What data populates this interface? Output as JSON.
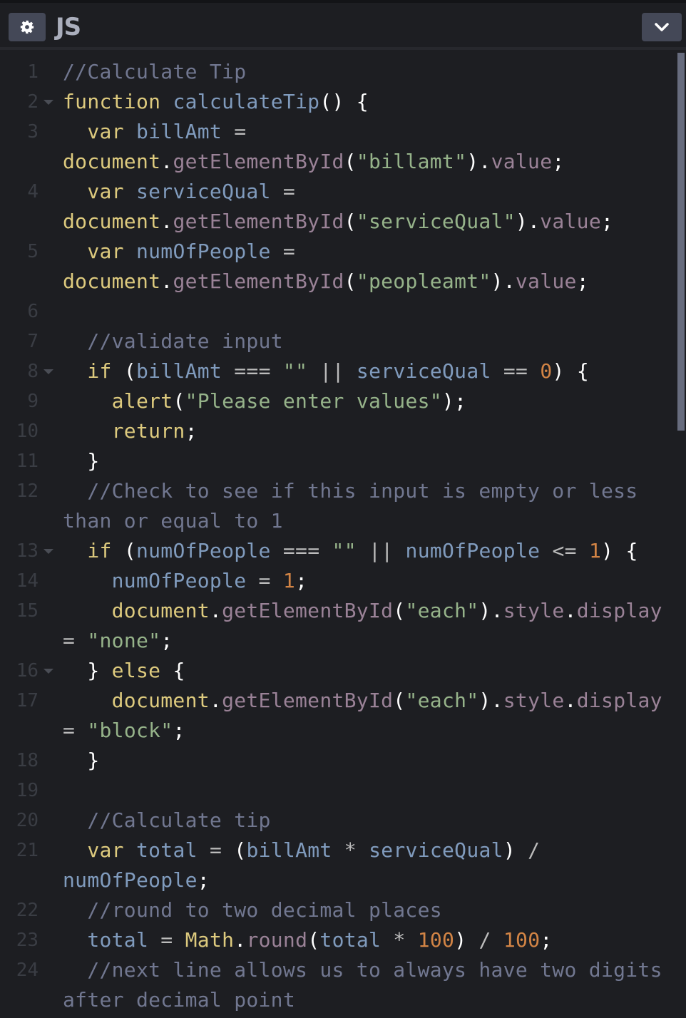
{
  "header": {
    "settings_icon": "gear-icon",
    "title": "JS",
    "collapse_icon": "chevron-down-icon"
  },
  "colors": {
    "background": "#1d1e22",
    "comment": "#717790",
    "keyword": "#ddca7e",
    "variable": "#809bbd",
    "property": "#9a8297",
    "string": "#96b38a",
    "number": "#d28445"
  },
  "code_lines": [
    {
      "n": "1",
      "fold": false,
      "tokens": [
        [
          "comment",
          "//Calculate Tip"
        ]
      ]
    },
    {
      "n": "2",
      "fold": true,
      "tokens": [
        [
          "keyword",
          "function"
        ],
        [
          "punct",
          " "
        ],
        [
          "def",
          "calculateTip"
        ],
        [
          "punct",
          "() {"
        ]
      ]
    },
    {
      "n": "3",
      "fold": false,
      "tokens": [
        [
          "punct",
          "  "
        ],
        [
          "keyword",
          "var"
        ],
        [
          "punct",
          " "
        ],
        [
          "def",
          "billAmt"
        ],
        [
          "punct",
          " "
        ],
        [
          "op",
          "="
        ],
        [
          "br",
          ""
        ],
        [
          "keyword",
          "document"
        ],
        [
          "punct",
          "."
        ],
        [
          "prop",
          "getElementById"
        ],
        [
          "punct",
          "("
        ],
        [
          "string",
          "\"billamt\""
        ],
        [
          "punct",
          ")."
        ],
        [
          "prop",
          "value"
        ],
        [
          "punct",
          ";"
        ]
      ]
    },
    {
      "n": "4",
      "fold": false,
      "tokens": [
        [
          "punct",
          "  "
        ],
        [
          "keyword",
          "var"
        ],
        [
          "punct",
          " "
        ],
        [
          "def",
          "serviceQual"
        ],
        [
          "punct",
          " "
        ],
        [
          "op",
          "="
        ],
        [
          "br",
          ""
        ],
        [
          "keyword",
          "document"
        ],
        [
          "punct",
          "."
        ],
        [
          "prop",
          "getElementById"
        ],
        [
          "punct",
          "("
        ],
        [
          "string",
          "\"serviceQual\""
        ],
        [
          "punct",
          ")."
        ],
        [
          "prop",
          "value"
        ],
        [
          "punct",
          ";"
        ]
      ]
    },
    {
      "n": "5",
      "fold": false,
      "tokens": [
        [
          "punct",
          "  "
        ],
        [
          "keyword",
          "var"
        ],
        [
          "punct",
          " "
        ],
        [
          "def",
          "numOfPeople"
        ],
        [
          "punct",
          " "
        ],
        [
          "op",
          "="
        ],
        [
          "br",
          ""
        ],
        [
          "keyword",
          "document"
        ],
        [
          "punct",
          "."
        ],
        [
          "prop",
          "getElementById"
        ],
        [
          "punct",
          "("
        ],
        [
          "string",
          "\"peopleamt\""
        ],
        [
          "punct",
          ")."
        ],
        [
          "prop",
          "value"
        ],
        [
          "punct",
          ";"
        ]
      ]
    },
    {
      "n": "6",
      "fold": false,
      "tokens": []
    },
    {
      "n": "7",
      "fold": false,
      "tokens": [
        [
          "punct",
          "  "
        ],
        [
          "comment",
          "//validate input"
        ]
      ]
    },
    {
      "n": "8",
      "fold": true,
      "tokens": [
        [
          "punct",
          "  "
        ],
        [
          "keyword",
          "if"
        ],
        [
          "punct",
          " ("
        ],
        [
          "var",
          "billAmt"
        ],
        [
          "punct",
          " "
        ],
        [
          "op",
          "==="
        ],
        [
          "punct",
          " "
        ],
        [
          "string",
          "\"\""
        ],
        [
          "punct",
          " "
        ],
        [
          "op",
          "||"
        ],
        [
          "punct",
          " "
        ],
        [
          "var",
          "serviceQual"
        ],
        [
          "punct",
          " "
        ],
        [
          "op",
          "=="
        ],
        [
          "punct",
          " "
        ],
        [
          "number",
          "0"
        ],
        [
          "punct",
          ") {"
        ]
      ]
    },
    {
      "n": "9",
      "fold": false,
      "tokens": [
        [
          "punct",
          "    "
        ],
        [
          "keyword",
          "alert"
        ],
        [
          "punct",
          "("
        ],
        [
          "string",
          "\"Please enter values\""
        ],
        [
          "punct",
          ");"
        ]
      ]
    },
    {
      "n": "10",
      "fold": false,
      "tokens": [
        [
          "punct",
          "    "
        ],
        [
          "keyword",
          "return"
        ],
        [
          "punct",
          ";"
        ]
      ]
    },
    {
      "n": "11",
      "fold": false,
      "tokens": [
        [
          "punct",
          "  }"
        ]
      ]
    },
    {
      "n": "12",
      "fold": false,
      "tokens": [
        [
          "punct",
          "  "
        ],
        [
          "comment",
          "//Check to see if this input is empty or less"
        ],
        [
          "br",
          ""
        ],
        [
          "comment",
          "than or equal to 1"
        ]
      ]
    },
    {
      "n": "13",
      "fold": true,
      "tokens": [
        [
          "punct",
          "  "
        ],
        [
          "keyword",
          "if"
        ],
        [
          "punct",
          " ("
        ],
        [
          "var",
          "numOfPeople"
        ],
        [
          "punct",
          " "
        ],
        [
          "op",
          "==="
        ],
        [
          "punct",
          " "
        ],
        [
          "string",
          "\"\""
        ],
        [
          "punct",
          " "
        ],
        [
          "op",
          "||"
        ],
        [
          "punct",
          " "
        ],
        [
          "var",
          "numOfPeople"
        ],
        [
          "punct",
          " "
        ],
        [
          "op",
          "<="
        ],
        [
          "punct",
          " "
        ],
        [
          "number",
          "1"
        ],
        [
          "punct",
          ") {"
        ]
      ]
    },
    {
      "n": "14",
      "fold": false,
      "tokens": [
        [
          "punct",
          "    "
        ],
        [
          "var",
          "numOfPeople"
        ],
        [
          "punct",
          " "
        ],
        [
          "op",
          "="
        ],
        [
          "punct",
          " "
        ],
        [
          "number",
          "1"
        ],
        [
          "punct",
          ";"
        ]
      ]
    },
    {
      "n": "15",
      "fold": false,
      "tokens": [
        [
          "punct",
          "    "
        ],
        [
          "keyword",
          "document"
        ],
        [
          "punct",
          "."
        ],
        [
          "prop",
          "getElementById"
        ],
        [
          "punct",
          "("
        ],
        [
          "string",
          "\"each\""
        ],
        [
          "punct",
          ")."
        ],
        [
          "prop",
          "style"
        ],
        [
          "punct",
          "."
        ],
        [
          "prop",
          "display"
        ],
        [
          "br",
          ""
        ],
        [
          "op",
          "="
        ],
        [
          "punct",
          " "
        ],
        [
          "string",
          "\"none\""
        ],
        [
          "punct",
          ";"
        ]
      ]
    },
    {
      "n": "16",
      "fold": true,
      "tokens": [
        [
          "punct",
          "  } "
        ],
        [
          "keyword",
          "else"
        ],
        [
          "punct",
          " {"
        ]
      ]
    },
    {
      "n": "17",
      "fold": false,
      "tokens": [
        [
          "punct",
          "    "
        ],
        [
          "keyword",
          "document"
        ],
        [
          "punct",
          "."
        ],
        [
          "prop",
          "getElementById"
        ],
        [
          "punct",
          "("
        ],
        [
          "string",
          "\"each\""
        ],
        [
          "punct",
          ")."
        ],
        [
          "prop",
          "style"
        ],
        [
          "punct",
          "."
        ],
        [
          "prop",
          "display"
        ],
        [
          "br",
          ""
        ],
        [
          "op",
          "="
        ],
        [
          "punct",
          " "
        ],
        [
          "string",
          "\"block\""
        ],
        [
          "punct",
          ";"
        ]
      ]
    },
    {
      "n": "18",
      "fold": false,
      "tokens": [
        [
          "punct",
          "  }"
        ]
      ]
    },
    {
      "n": "19",
      "fold": false,
      "tokens": []
    },
    {
      "n": "20",
      "fold": false,
      "tokens": [
        [
          "punct",
          "  "
        ],
        [
          "comment",
          "//Calculate tip"
        ]
      ]
    },
    {
      "n": "21",
      "fold": false,
      "tokens": [
        [
          "punct",
          "  "
        ],
        [
          "keyword",
          "var"
        ],
        [
          "punct",
          " "
        ],
        [
          "def",
          "total"
        ],
        [
          "punct",
          " "
        ],
        [
          "op",
          "="
        ],
        [
          "punct",
          " ("
        ],
        [
          "var",
          "billAmt"
        ],
        [
          "punct",
          " "
        ],
        [
          "op",
          "*"
        ],
        [
          "punct",
          " "
        ],
        [
          "var",
          "serviceQual"
        ],
        [
          "punct",
          ") "
        ],
        [
          "op",
          "/"
        ],
        [
          "br",
          ""
        ],
        [
          "var",
          "numOfPeople"
        ],
        [
          "punct",
          ";"
        ]
      ]
    },
    {
      "n": "22",
      "fold": false,
      "tokens": [
        [
          "punct",
          "  "
        ],
        [
          "comment",
          "//round to two decimal places"
        ]
      ]
    },
    {
      "n": "23",
      "fold": false,
      "tokens": [
        [
          "punct",
          "  "
        ],
        [
          "var",
          "total"
        ],
        [
          "punct",
          " "
        ],
        [
          "op",
          "="
        ],
        [
          "punct",
          " "
        ],
        [
          "builtin",
          "Math"
        ],
        [
          "punct",
          "."
        ],
        [
          "prop",
          "round"
        ],
        [
          "punct",
          "("
        ],
        [
          "var",
          "total"
        ],
        [
          "punct",
          " "
        ],
        [
          "op",
          "*"
        ],
        [
          "punct",
          " "
        ],
        [
          "number",
          "100"
        ],
        [
          "punct",
          ") "
        ],
        [
          "op",
          "/"
        ],
        [
          "punct",
          " "
        ],
        [
          "number",
          "100"
        ],
        [
          "punct",
          ";"
        ]
      ]
    },
    {
      "n": "24",
      "fold": false,
      "tokens": [
        [
          "punct",
          "  "
        ],
        [
          "comment",
          "//next line allows us to always have two digits"
        ],
        [
          "br",
          ""
        ],
        [
          "comment",
          "after decimal point"
        ]
      ]
    }
  ]
}
